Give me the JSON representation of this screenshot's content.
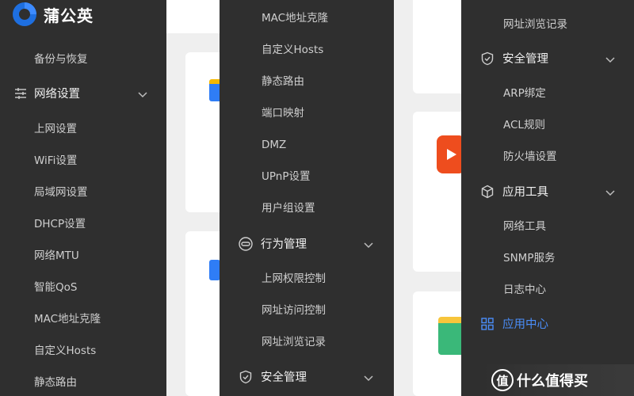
{
  "brand": {
    "name": "蒲公英",
    "accent": "#2a6fe0"
  },
  "panel1": {
    "top_item": "备份与恢复",
    "group": {
      "label": "网络设置",
      "icon": "sliders-icon",
      "chevron": "chevron-down-icon"
    },
    "items": [
      "上网设置",
      "WiFi设置",
      "局域网设置",
      "DHCP设置",
      "网络MTU",
      "智能QoS",
      "MAC地址克隆",
      "自定义Hosts",
      "静态路由"
    ]
  },
  "panel2": {
    "items_top": [
      "MAC地址克隆",
      "自定义Hosts",
      "静态路由",
      "端口映射",
      "DMZ",
      "UPnP设置",
      "用户组设置"
    ],
    "group1": {
      "label": "行为管理",
      "icon": "link-icon",
      "chevron": "chevron-down-icon"
    },
    "items_mid": [
      "上网权限控制",
      "网址访问控制",
      "网址浏览记录"
    ],
    "group2": {
      "label": "安全管理",
      "icon": "shield-icon",
      "chevron": "chevron-down-icon"
    }
  },
  "panel3": {
    "top_item": "网址浏览记录",
    "group1": {
      "label": "安全管理",
      "icon": "shield-icon",
      "chevron": "chevron-down-icon"
    },
    "items1": [
      "ARP绑定",
      "ACL规则",
      "防火墙设置"
    ],
    "group2": {
      "label": "应用工具",
      "icon": "cube-icon",
      "chevron": "chevron-down-icon"
    },
    "items2": [
      "网络工具",
      "SNMP服务",
      "日志中心"
    ],
    "active_item": {
      "label": "应用中心",
      "icon": "grid-icon",
      "color": "#4a8df8"
    }
  },
  "watermark": {
    "text": "什么值得买",
    "badge": "值"
  }
}
